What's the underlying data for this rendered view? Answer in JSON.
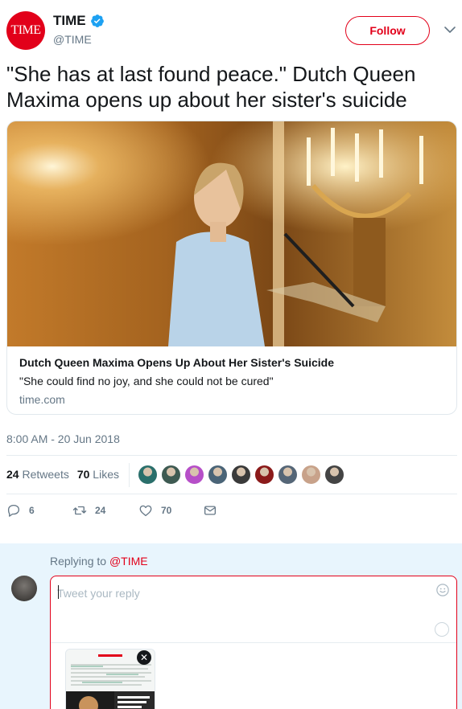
{
  "account": {
    "avatar_text": "TIME",
    "name": "TIME",
    "handle": "@TIME",
    "brand_color": "#e2001a",
    "verified_color": "#1da1f2"
  },
  "header": {
    "follow_label": "Follow",
    "more_icon": "chevron-down-icon"
  },
  "tweet": {
    "text": "\"She has at last found peace.\" Dutch Queen Maxima opens up about her sister's suicide",
    "timestamp": "8:00 AM - 20 Jun 2018"
  },
  "card": {
    "title": "Dutch Queen Maxima Opens Up About Her Sister's Suicide",
    "description": "\"She could find no joy, and she could not be cured\"",
    "domain": "time.com"
  },
  "stats": {
    "retweets_count": "24",
    "retweets_label": "Retweets",
    "likes_count": "70",
    "likes_label": "Likes",
    "liker_colors": [
      "#2a6f6b",
      "#3e5a52",
      "#b64fc8",
      "#4a6477",
      "#3a3a3a",
      "#8b1a1a",
      "#556677",
      "#c8a28a",
      "#444444"
    ]
  },
  "actions": {
    "reply_count": "6",
    "retweet_count": "24",
    "like_count": "70"
  },
  "reply": {
    "replying_to_label": "Replying to",
    "replying_to_handle": "@TIME",
    "placeholder": "Tweet your reply"
  }
}
